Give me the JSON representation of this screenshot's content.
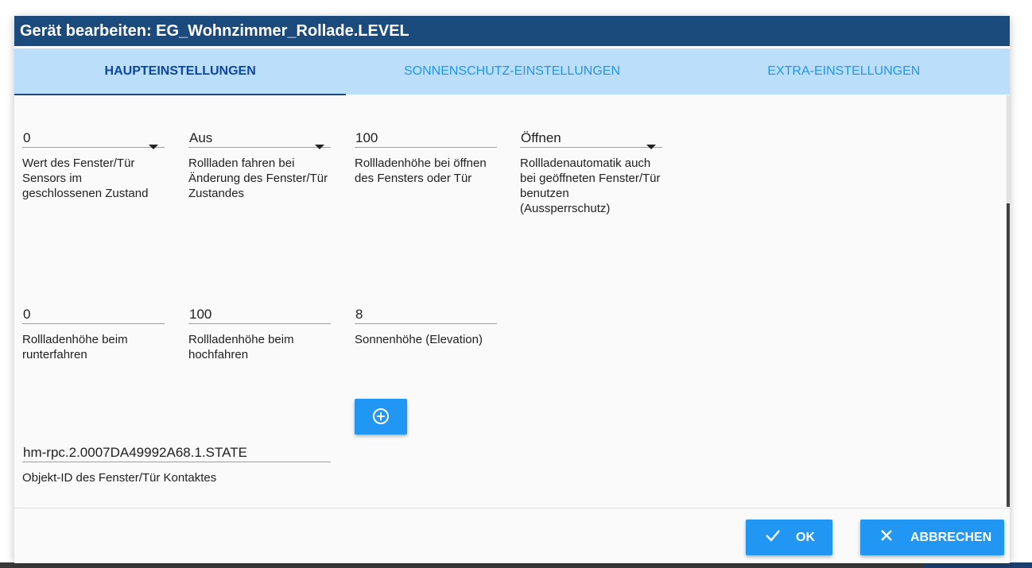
{
  "dialog": {
    "title": "Gerät bearbeiten: EG_Wohnzimmer_Rollade.LEVEL"
  },
  "tabs": [
    {
      "label": "HAUPTEINSTELLUNGEN",
      "active": true
    },
    {
      "label": "SONNENSCHUTZ-EINSTELLUNGEN",
      "active": false
    },
    {
      "label": "EXTRA-EINSTELLUNGEN",
      "active": false
    }
  ],
  "fields": {
    "window_closed_value": {
      "value": "0",
      "helper": "Wert des Fenster/Tür Sensors im geschlossenen Zustand",
      "type": "select"
    },
    "move_on_window_change": {
      "value": "Aus",
      "helper": "Rollladen fahren bei Änderung des Fenster/Tür Zustandes",
      "type": "select"
    },
    "height_on_window_open": {
      "value": "100",
      "helper": "Rollladenhöhe bei öffnen des Fensters oder Tür",
      "type": "input"
    },
    "automatic_on_open_window": {
      "value": "Öffnen",
      "helper": "Rollladenautomatik auch bei geöffneten Fenster/Tür benutzen (Aussperrschutz)",
      "type": "select"
    },
    "height_down": {
      "value": "0",
      "helper": "Rollladenhöhe beim runterfahren",
      "type": "input"
    },
    "height_up": {
      "value": "100",
      "helper": "Rollladenhöhe beim hochfahren",
      "type": "input"
    },
    "sun_elevation": {
      "value": "8",
      "helper": "Sonnenhöhe (Elevation)",
      "type": "input"
    },
    "window_contact_id": {
      "value": "hm-rpc.2.0007DA49992A68.1.STATE",
      "helper": "Objekt-ID des Fenster/Tür Kontaktes",
      "type": "input"
    }
  },
  "add_button": {
    "icon": "plus-circle-icon"
  },
  "footer": {
    "ok_label": "OK",
    "cancel_label": "ABBRECHEN",
    "ok_icon": "checkmark-icon",
    "cancel_icon": "close-icon"
  },
  "colors": {
    "title_bar": "#1b4a7d",
    "tab_bar": "#bbdefb",
    "tab_active_text": "#0d47a1",
    "tab_inactive_text": "#2196f3",
    "button": "#2196f3"
  }
}
